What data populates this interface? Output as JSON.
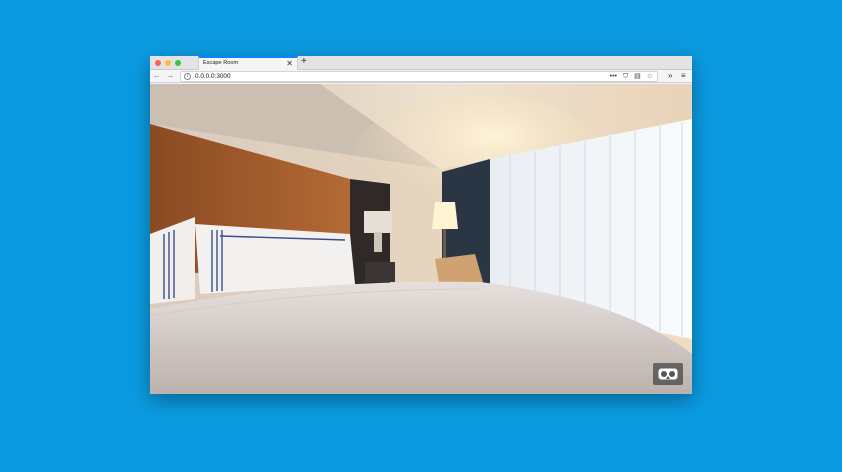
{
  "browser": {
    "tab": {
      "title": "Escape Room",
      "close_glyph": "✕"
    },
    "new_tab_glyph": "+",
    "nav": {
      "back_glyph": "←",
      "forward_glyph": "→",
      "url": "0.0.0.0:3000",
      "info_glyph": "i",
      "more_glyph": "•••",
      "pocket_glyph": "⛉",
      "reader_glyph": "▤",
      "bookmark_glyph": "☆",
      "overflow_glyph": "»",
      "menu_glyph": "≡"
    }
  },
  "scene": {
    "description_icon": "vr-headset-icon"
  },
  "colors": {
    "background": "#0b9ae0",
    "tab_accent": "#0a84ff"
  }
}
